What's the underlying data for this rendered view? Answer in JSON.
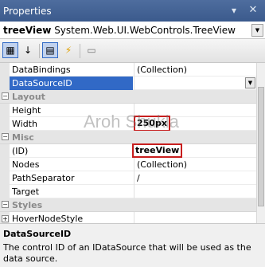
{
  "window": {
    "title": "Properties"
  },
  "object_selector": {
    "name": "treeView",
    "type": "System.Web.UI.WebControls.TreeView"
  },
  "toolbar": {
    "buttons": [
      {
        "icon": "categorized-icon",
        "glyph": "▦",
        "active": true
      },
      {
        "icon": "alphabetical-icon",
        "glyph": "↓",
        "active": false
      },
      {
        "icon": "properties-icon",
        "glyph": "▤",
        "active": true
      },
      {
        "icon": "events-icon",
        "glyph": "⚡",
        "active": false
      },
      {
        "icon": "property-pages-icon",
        "glyph": "▭",
        "active": false
      }
    ]
  },
  "grid": {
    "rows": [
      {
        "kind": "prop",
        "name": "DataBindings",
        "value": "(Collection)"
      },
      {
        "kind": "prop",
        "name": "DataSourceID",
        "value": "",
        "selected": true
      },
      {
        "kind": "cat",
        "name": "Layout"
      },
      {
        "kind": "prop",
        "name": "Height",
        "value": ""
      },
      {
        "kind": "prop",
        "name": "Width",
        "value": "250px",
        "highlight": true
      },
      {
        "kind": "cat",
        "name": "Misc"
      },
      {
        "kind": "prop",
        "name": "(ID)",
        "value": "treeView",
        "highlight": true
      },
      {
        "kind": "prop",
        "name": "Nodes",
        "value": "(Collection)"
      },
      {
        "kind": "prop",
        "name": "PathSeparator",
        "value": "/"
      },
      {
        "kind": "prop",
        "name": "Target",
        "value": ""
      },
      {
        "kind": "cat",
        "name": "Styles"
      },
      {
        "kind": "prop",
        "name": "HoverNodeStyle",
        "value": "",
        "expandable": true
      }
    ]
  },
  "watermark": "Aroh Shukla",
  "description": {
    "title": "DataSourceID",
    "text": "The control ID of an IDataSource that will be used as the data source."
  },
  "colors": {
    "title_bar": "#3b5a8c",
    "selection": "#3169c6",
    "highlight_border": "#c81e1e"
  }
}
